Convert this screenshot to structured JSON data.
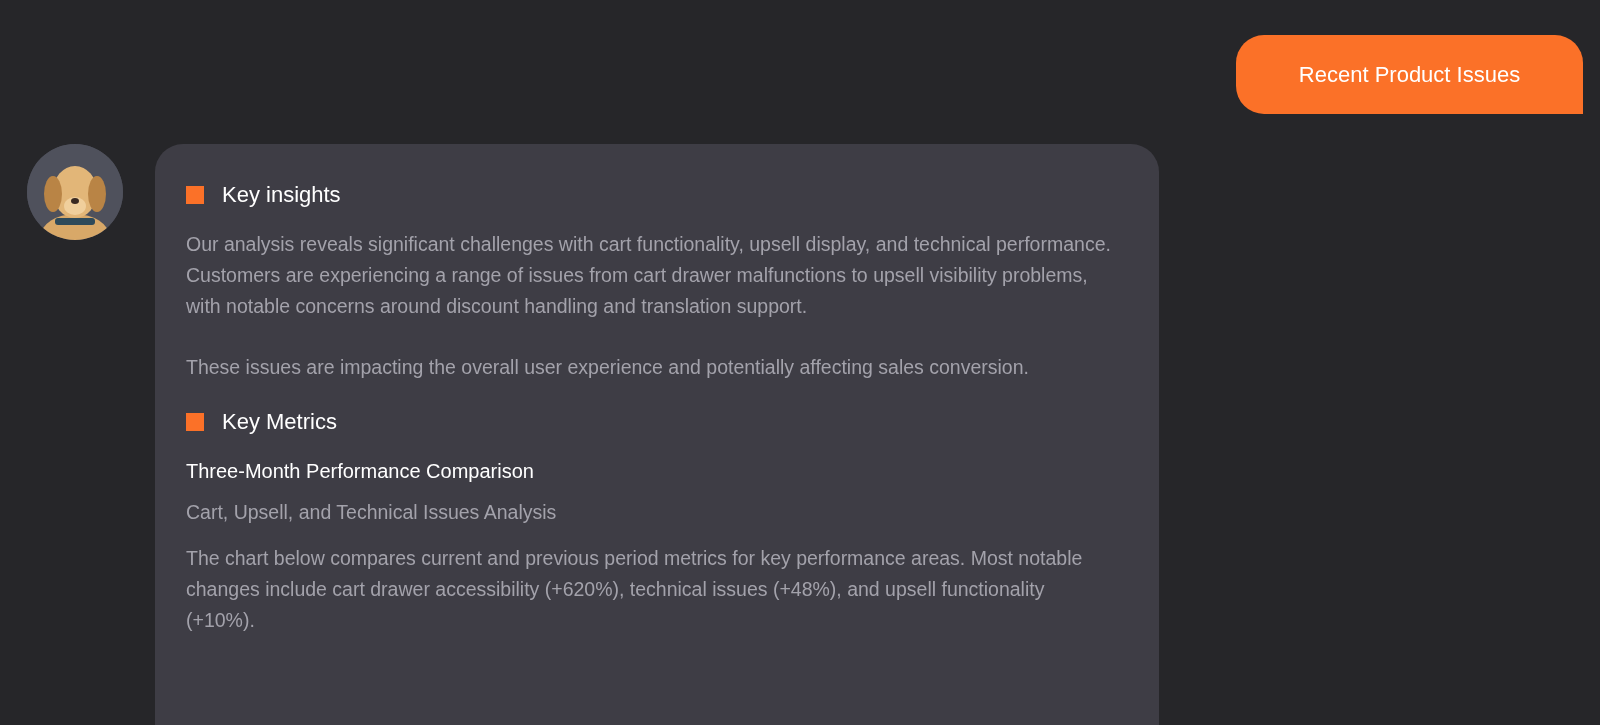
{
  "user_message": {
    "text": "Recent Product Issues"
  },
  "assistant": {
    "sections": [
      {
        "heading": "Key insights",
        "paragraphs": [
          "Our analysis reveals significant challenges with cart functionality, upsell display, and technical performance. Customers are experiencing a range of issues from cart drawer malfunctions to upsell visibility problems, with notable concerns around discount handling and translation support.",
          "These issues are impacting the overall user experience and potentially affecting sales conversion."
        ]
      },
      {
        "heading": "Key Metrics",
        "subtitle": "Three-Month Performance Comparison",
        "caption": "Cart, Upsell, and Technical Issues Analysis",
        "paragraphs": [
          "The chart below compares current and previous period metrics for key performance areas. Most notable changes include cart drawer accessibility (+620%), technical issues (+48%), and upsell functionality (+10%)."
        ]
      }
    ]
  }
}
